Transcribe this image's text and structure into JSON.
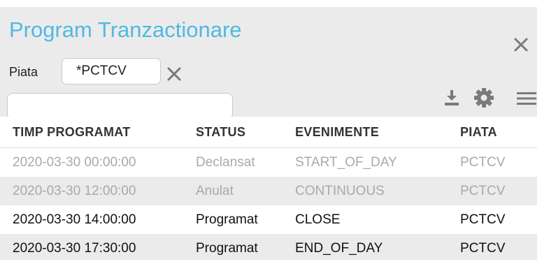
{
  "panel": {
    "title": "Program Tranzactionare"
  },
  "filter": {
    "label": "Piata",
    "chip_value": "*PCTCV",
    "search_placeholder": ""
  },
  "icons": {
    "close": "close-icon",
    "chip_clear": "close-icon",
    "download": "download-icon",
    "settings": "gear-icon",
    "menu": "menu-icon"
  },
  "colors": {
    "title": "#4fb9e3",
    "header_bg": "#ebebeb",
    "muted_text": "#a9a9a9",
    "active_text": "#111111"
  },
  "table": {
    "columns": [
      "TIMP PROGRAMAT",
      "STATUS",
      "EVENIMENTE",
      "PIATA"
    ],
    "rows": [
      [
        "2020-03-30 00:00:00",
        "Declansat",
        "START_OF_DAY",
        "PCTCV"
      ],
      [
        "2020-03-30 12:00:00",
        "Anulat",
        "CONTINUOUS",
        "PCTCV"
      ],
      [
        "2020-03-30 14:00:00",
        "Programat",
        "CLOSE",
        "PCTCV"
      ],
      [
        "2020-03-30 17:30:00",
        "Programat",
        "END_OF_DAY",
        "PCTCV"
      ]
    ]
  }
}
